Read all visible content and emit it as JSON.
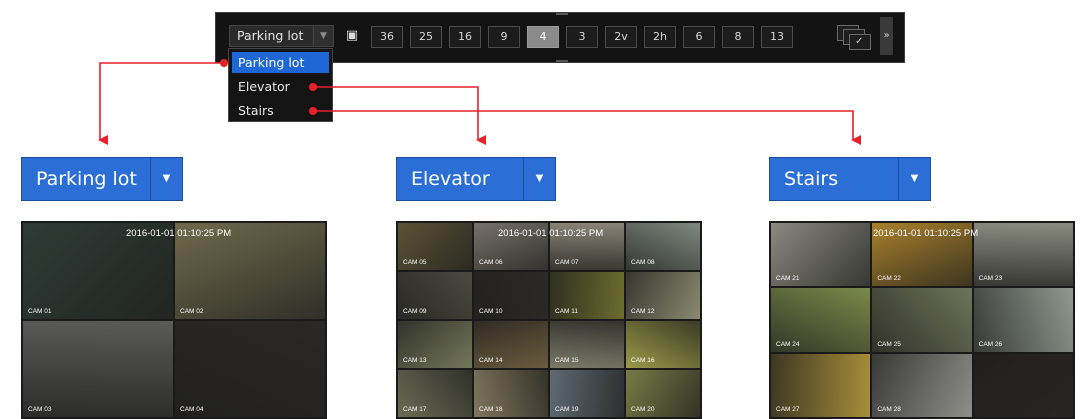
{
  "toolbar": {
    "group_select": {
      "value": "Parking lot"
    },
    "sequence_icon": "sequence-icon",
    "split_buttons": [
      {
        "label": "36",
        "active": false
      },
      {
        "label": "25",
        "active": false
      },
      {
        "label": "16",
        "active": false
      },
      {
        "label": "9",
        "active": false
      },
      {
        "label": "4",
        "active": true
      },
      {
        "label": "3",
        "active": false
      },
      {
        "label": "2v",
        "active": false
      },
      {
        "label": "2h",
        "active": false
      },
      {
        "label": "6",
        "active": false
      },
      {
        "label": "8",
        "active": false
      },
      {
        "label": "13",
        "active": false
      }
    ],
    "next_label": "»"
  },
  "dropdown": {
    "options": [
      {
        "label": "Parking lot",
        "selected": true
      },
      {
        "label": "Elevator",
        "selected": false
      },
      {
        "label": "Stairs",
        "selected": false
      }
    ]
  },
  "panels": [
    {
      "label": "Parking lot",
      "timestamp": "2016-01-01  01:10:25 PM",
      "columns": 2,
      "cells": [
        {
          "name": "CAM 01",
          "tone": "#2e3b36"
        },
        {
          "name": "CAM 02",
          "tone": "#6f6a4c"
        },
        {
          "name": "CAM 03",
          "tone": "#5a5a58"
        },
        {
          "name": "CAM 04",
          "tone": "#2a2826"
        }
      ]
    },
    {
      "label": "Elevator",
      "timestamp": "2016-01-01  01:10:25 PM",
      "columns": 4,
      "cells": [
        {
          "name": "CAM 05",
          "tone": "#5b5336"
        },
        {
          "name": "CAM 06",
          "tone": "#77726a"
        },
        {
          "name": "CAM 07",
          "tone": "#8a8576"
        },
        {
          "name": "CAM 08",
          "tone": "#7f8a80"
        },
        {
          "name": "CAM 09",
          "tone": "#4b4a40"
        },
        {
          "name": "CAM 10",
          "tone": "#2b2a27"
        },
        {
          "name": "CAM 11",
          "tone": "#6b6c2e"
        },
        {
          "name": "CAM 12",
          "tone": "#8b8a70"
        },
        {
          "name": "CAM 13",
          "tone": "#74785a"
        },
        {
          "name": "CAM 14",
          "tone": "#6b5b3e"
        },
        {
          "name": "CAM 15",
          "tone": "#7b7a68"
        },
        {
          "name": "CAM 16",
          "tone": "#9a9a48"
        },
        {
          "name": "CAM 17",
          "tone": "#6a6c55"
        },
        {
          "name": "CAM 18",
          "tone": "#80765c"
        },
        {
          "name": "CAM 19",
          "tone": "#5e6a72"
        },
        {
          "name": "CAM 20",
          "tone": "#767c46"
        }
      ]
    },
    {
      "label": "Stairs",
      "timestamp": "2016-01-01  01:10:25 PM",
      "columns": 3,
      "cells": [
        {
          "name": "CAM 21",
          "tone": "#8a8a80"
        },
        {
          "name": "CAM 22",
          "tone": "#a8802c"
        },
        {
          "name": "CAM 23",
          "tone": "#8a8c80"
        },
        {
          "name": "CAM 24",
          "tone": "#7a8a4a"
        },
        {
          "name": "CAM 25",
          "tone": "#6e7458"
        },
        {
          "name": "CAM 26",
          "tone": "#8f9a90"
        },
        {
          "name": "CAM 27",
          "tone": "#a88e3a"
        },
        {
          "name": "CAM 28",
          "tone": "#8f8f8a"
        },
        {
          "name": "",
          "tone": "#2a2424"
        }
      ]
    }
  ],
  "colors": {
    "accent": "#2a6ed6",
    "connector": "#e8202a",
    "toolbar_bg": "#131313"
  }
}
